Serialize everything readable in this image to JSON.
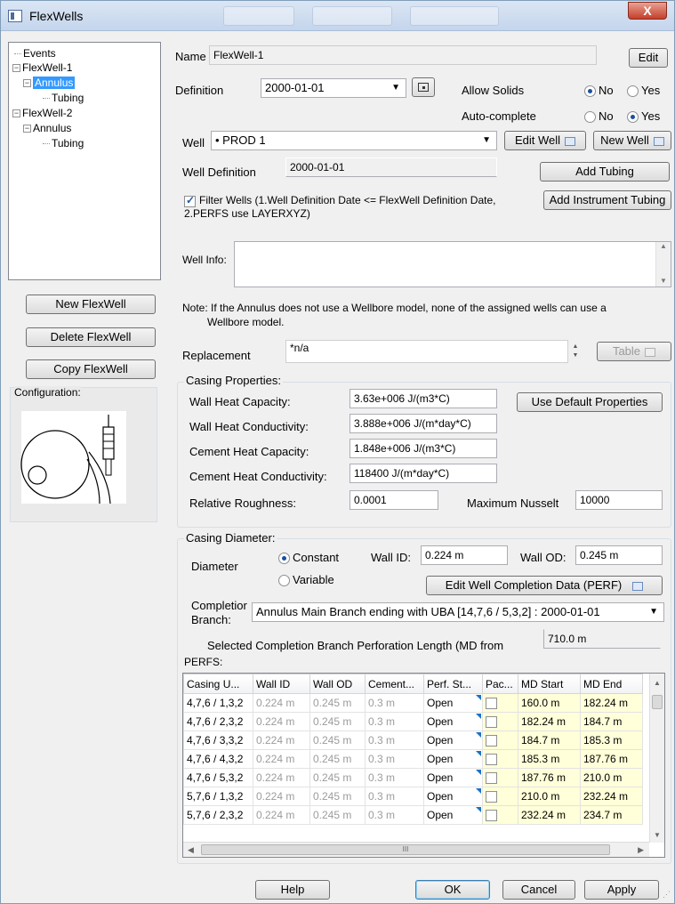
{
  "window": {
    "title": "FlexWells",
    "close_glyph": "X"
  },
  "tree": {
    "events": "Events",
    "flexwell1": "FlexWell-1",
    "annulus1": "Annulus",
    "tubing1": "Tubing",
    "flexwell2": "FlexWell-2",
    "annulus2": "Annulus",
    "tubing2": "Tubing"
  },
  "left_buttons": {
    "new": "New FlexWell",
    "delete": "Delete FlexWell",
    "copy": "Copy FlexWell"
  },
  "configuration_label": "Configuration:",
  "name": {
    "label": "Name",
    "value": "FlexWell-1",
    "edit": "Edit"
  },
  "definition": {
    "label": "Definition",
    "value": "2000-01-01",
    "allow_solids": {
      "label": "Allow Solids",
      "no": "No",
      "yes": "Yes",
      "selected": "No"
    },
    "auto_complete": {
      "label": "Auto-complete",
      "no": "No",
      "yes": "Yes",
      "selected": "Yes"
    }
  },
  "well": {
    "label": "Well",
    "value": "• PROD 1",
    "edit_well": "Edit Well",
    "new_well": "New Well"
  },
  "well_definition": {
    "label": "Well Definition",
    "value": "2000-01-01",
    "add_tubing": "Add Tubing",
    "add_instrument_tubing": "Add Instrument Tubing"
  },
  "filter": {
    "checked": true,
    "line1": "Filter Wells (1.Well Definition Date <= FlexWell Definition Date,",
    "line2": "2.PERFS use LAYERXYZ)"
  },
  "well_info": {
    "label": "Well Info:",
    "value": ""
  },
  "note": {
    "line1": "Note: If the Annulus does not use a Wellbore model, none of the assigned wells can use a",
    "line2": "Wellbore model."
  },
  "replacement": {
    "label": "Replacement",
    "value": "*n/a",
    "table": "Table"
  },
  "casing_properties": {
    "title": "Casing Properties:",
    "wall_heat_capacity": {
      "label": "Wall Heat Capacity:",
      "value": "3.63e+006  J/(m3*C)"
    },
    "wall_heat_conductivity": {
      "label": "Wall Heat Conductivity:",
      "value": "3.888e+006  J/(m*day*C)"
    },
    "cement_heat_capacity": {
      "label": "Cement Heat Capacity:",
      "value": "1.848e+006  J/(m3*C)"
    },
    "cement_heat_conductivity": {
      "label": "Cement Heat Conductivity:",
      "value": "118400  J/(m*day*C)"
    },
    "relative_roughness": {
      "label": "Relative Roughness:",
      "value": "0.0001"
    },
    "maximum_nusselt": {
      "label": "Maximum Nusselt",
      "value": "10000"
    },
    "use_default": "Use Default Properties"
  },
  "casing_diameter": {
    "title": "Casing Diameter:",
    "diameter_label": "Diameter",
    "constant": "Constant",
    "variable": "Variable",
    "selected": "Constant",
    "wall_id": {
      "label": "Wall ID:",
      "value": "0.224  m"
    },
    "wall_od": {
      "label": "Wall OD:",
      "value": "0.245  m"
    },
    "edit_perf": "Edit Well Completion Data (PERF)",
    "branch_label_1": "Completior",
    "branch_label_2": "Branch:",
    "branch_value": "Annulus Main Branch ending with UBA [14,7,6 / 5,3,2]  :  2000-01-01",
    "perf_length_label": "Selected Completion Branch Perforation Length (MD from",
    "perf_length_value": "710.0  m"
  },
  "perfs": {
    "title": "PERFS:",
    "columns": [
      "Casing U...",
      "Wall ID",
      "Wall OD",
      "Cement...",
      "Perf. St...",
      "Pac...",
      "MD Start",
      "MD End"
    ],
    "rows": [
      [
        "4,7,6 / 1,3,2",
        "0.224  m",
        "0.245  m",
        "0.3  m",
        "Open",
        "",
        "160.0  m",
        "182.24  m"
      ],
      [
        "4,7,6 / 2,3,2",
        "0.224  m",
        "0.245  m",
        "0.3  m",
        "Open",
        "",
        "182.24  m",
        "184.7  m"
      ],
      [
        "4,7,6 / 3,3,2",
        "0.224  m",
        "0.245  m",
        "0.3  m",
        "Open",
        "",
        "184.7  m",
        "185.3  m"
      ],
      [
        "4,7,6 / 4,3,2",
        "0.224  m",
        "0.245  m",
        "0.3  m",
        "Open",
        "",
        "185.3  m",
        "187.76  m"
      ],
      [
        "4,7,6 / 5,3,2",
        "0.224  m",
        "0.245  m",
        "0.3  m",
        "Open",
        "",
        "187.76  m",
        "210.0  m"
      ],
      [
        "5,7,6 / 1,3,2",
        "0.224  m",
        "0.245  m",
        "0.3  m",
        "Open",
        "",
        "210.0  m",
        "232.24  m"
      ],
      [
        "5,7,6 / 2,3,2",
        "0.224  m",
        "0.245  m",
        "0.3  m",
        "Open",
        "",
        "232.24  m",
        "234.7  m"
      ]
    ],
    "scroll_grip": "III"
  },
  "footer": {
    "help": "Help",
    "ok": "OK",
    "cancel": "Cancel",
    "apply": "Apply"
  }
}
